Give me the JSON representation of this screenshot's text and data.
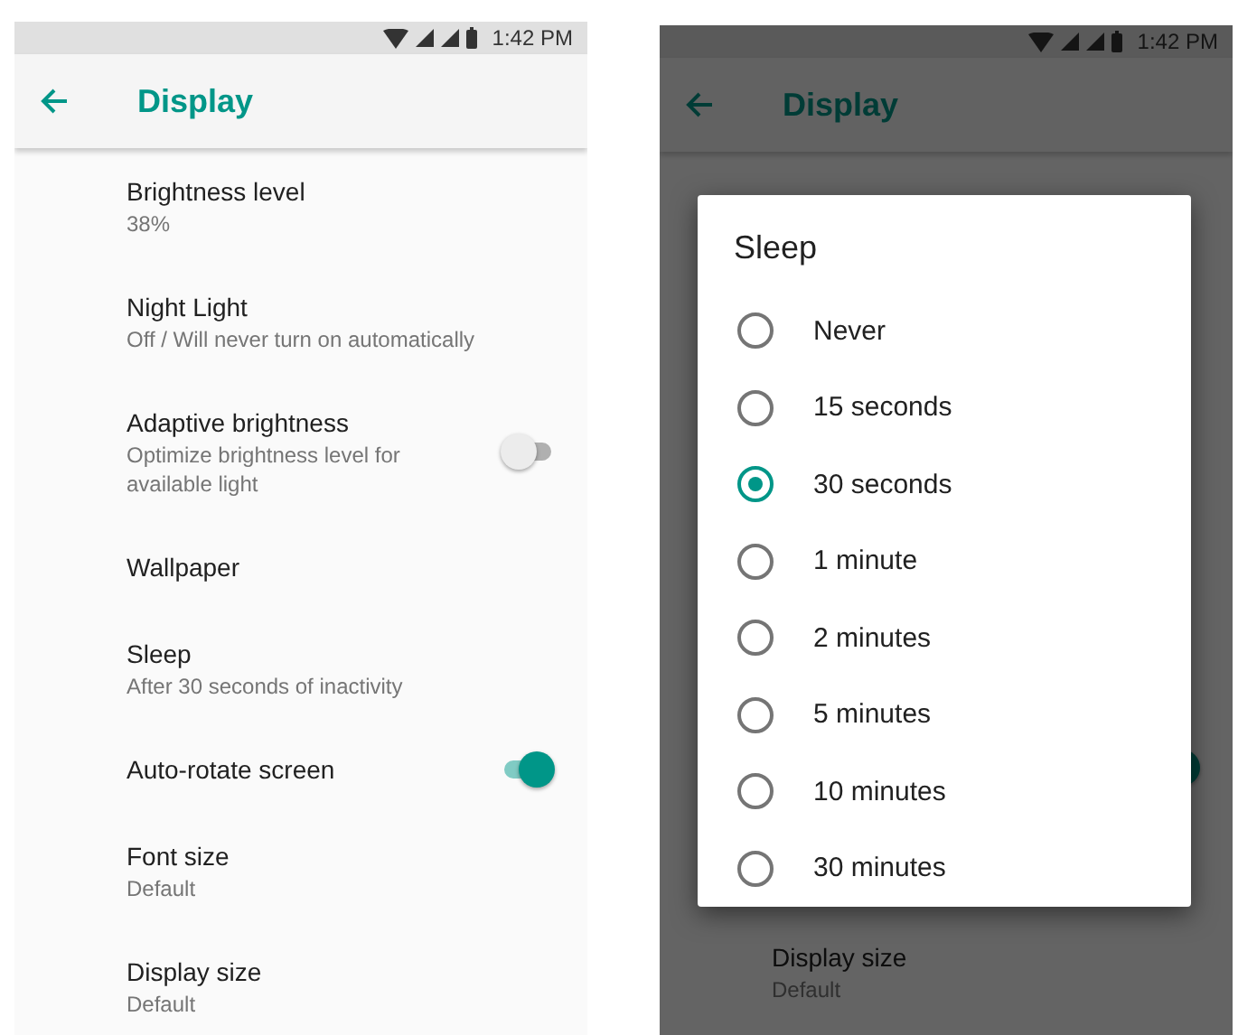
{
  "screens": [
    {
      "status_bar": {
        "time": "1:42 PM"
      },
      "title": "Display",
      "settings": [
        {
          "kind": "text",
          "title": "Brightness level",
          "subtitle": "38%"
        },
        {
          "kind": "text",
          "title": "Night Light",
          "subtitle": "Off / Will never turn on automatically"
        },
        {
          "kind": "toggle",
          "title": "Adaptive brightness",
          "subtitle": "Optimize brightness level for available light",
          "on": false
        },
        {
          "kind": "text",
          "title": "Wallpaper"
        },
        {
          "kind": "text",
          "title": "Sleep",
          "subtitle": "After 30 seconds of inactivity"
        },
        {
          "kind": "toggle",
          "title": "Auto-rotate screen",
          "on": true
        },
        {
          "kind": "text",
          "title": "Font size",
          "subtitle": "Default"
        },
        {
          "kind": "text",
          "title": "Display size",
          "subtitle": "Default"
        }
      ]
    },
    {
      "status_bar": {
        "time": "1:42 PM"
      },
      "title": "Display",
      "settings": [
        {
          "kind": "toggle-only",
          "on": true
        },
        {
          "kind": "text",
          "title": "Display size",
          "subtitle": "Default"
        }
      ],
      "dialog": {
        "title": "Sleep",
        "options": [
          {
            "label": "Never",
            "selected": false
          },
          {
            "label": "15 seconds",
            "selected": false
          },
          {
            "label": "30 seconds",
            "selected": true
          },
          {
            "label": "1 minute",
            "selected": false
          },
          {
            "label": "2 minutes",
            "selected": false
          },
          {
            "label": "5 minutes",
            "selected": false
          },
          {
            "label": "10 minutes",
            "selected": false
          },
          {
            "label": "30 minutes",
            "selected": false
          }
        ]
      }
    }
  ]
}
